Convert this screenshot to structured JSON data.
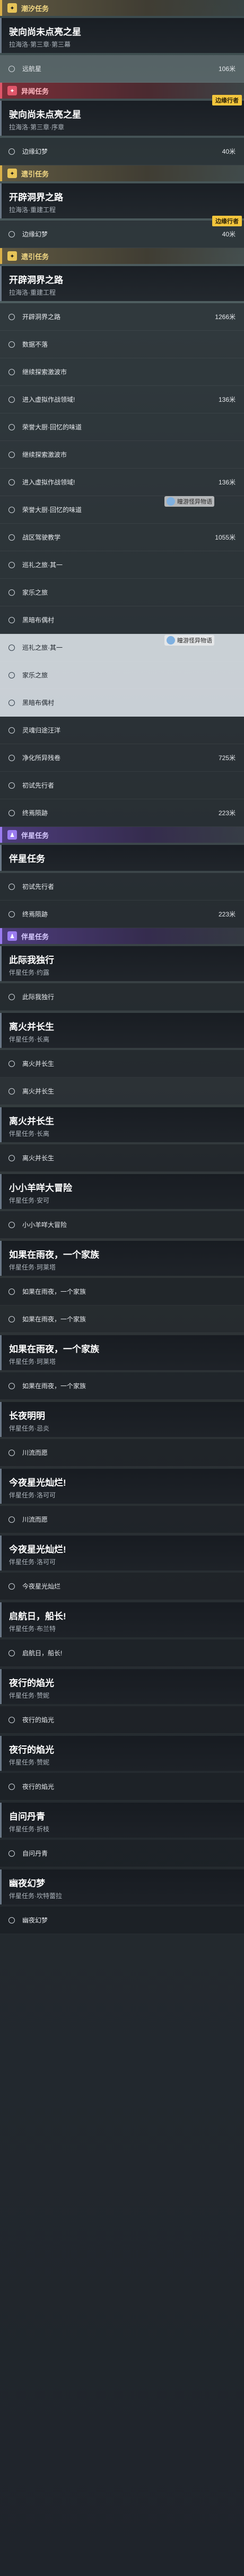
{
  "blocks": [
    {
      "type": "header",
      "style": "yellow",
      "icon": "✦",
      "text": "潮汐任务"
    },
    {
      "type": "card",
      "title": "驶向尚未点亮之星",
      "sub": "拉海洛·第三章·第三幕"
    },
    {
      "type": "row",
      "text": "远航星",
      "dist": "106米",
      "style": "sel"
    },
    {
      "type": "header",
      "style": "red",
      "icon": "✦",
      "text": "异闻任务"
    },
    {
      "type": "card",
      "title": "驶向尚未点亮之星",
      "sub": "拉海洛·第三章·序章",
      "tag": "边缘行者"
    },
    {
      "type": "row",
      "text": "边缘幻梦",
      "dist": "40米"
    },
    {
      "type": "header",
      "style": "yellow",
      "icon": "✦",
      "text": "遗引任务"
    },
    {
      "type": "card",
      "title": "开辟洞界之路",
      "sub": "拉海洛·重建工程"
    },
    {
      "type": "row",
      "text": "边缘幻梦",
      "dist": "40米",
      "tag": "边缘行者"
    },
    {
      "type": "header",
      "style": "yellow",
      "icon": "✦",
      "text": "遗引任务"
    },
    {
      "type": "card",
      "title": "开辟洞界之路",
      "sub": "拉海洛·重建工程"
    },
    {
      "type": "row",
      "text": "开辟洞界之路",
      "dist": "1266米"
    },
    {
      "type": "row",
      "text": "数据不落"
    },
    {
      "type": "row",
      "text": "继续探索激波市"
    },
    {
      "type": "row",
      "text": "进入虚拟作战领域!",
      "dist": "136米"
    },
    {
      "type": "row",
      "text": "荣誉大厨·回忆的味道"
    },
    {
      "type": "row",
      "text": "继续探索激波市"
    },
    {
      "type": "row",
      "text": "进入虚拟作战领域!",
      "dist": "136米"
    },
    {
      "type": "row",
      "text": "荣誉大厨·回忆的味道"
    },
    {
      "type": "row",
      "text": "战区驾驶教学",
      "dist": "1055米"
    },
    {
      "type": "row",
      "text": "巡礼之旅·其一"
    },
    {
      "type": "row",
      "text": "家乐之旅"
    },
    {
      "type": "row",
      "text": "黑暗布偶村"
    },
    {
      "type": "row",
      "text": "巡礼之旅·其一",
      "style": "light"
    },
    {
      "type": "row",
      "text": "家乐之旅",
      "style": "light"
    },
    {
      "type": "row",
      "text": "黑暗布偶村",
      "style": "light"
    },
    {
      "type": "row",
      "text": "灵魂归途汪洋"
    },
    {
      "type": "row",
      "text": "净化所异残卷",
      "dist": "725米"
    },
    {
      "type": "row",
      "text": "初试先行者"
    },
    {
      "type": "row",
      "text": "终焉陨跡",
      "dist": "223米"
    },
    {
      "type": "header",
      "style": "purple",
      "icon": "♟",
      "text": "伴星任务"
    },
    {
      "type": "card",
      "title": "伴星任务",
      "sub": ""
    },
    {
      "type": "row",
      "text": "初试先行者"
    },
    {
      "type": "row",
      "text": "终焉陨跡",
      "dist": "223米"
    },
    {
      "type": "header",
      "style": "purple",
      "icon": "♟",
      "text": "伴星任务"
    },
    {
      "type": "card",
      "title": "此际我独行",
      "sub": "伴星任务·约露"
    },
    {
      "type": "row",
      "text": "此际我独行"
    },
    {
      "type": "card",
      "title": "离火并长生",
      "sub": "伴星任务·长离"
    },
    {
      "type": "row",
      "text": "离火并长生"
    },
    {
      "type": "row",
      "text": "离火并长生",
      "style": "dim"
    },
    {
      "type": "card",
      "title": "离火并长生",
      "sub": "伴星任务·长离"
    },
    {
      "type": "row",
      "text": "离火并长生"
    },
    {
      "type": "card",
      "title": "小小羊咩大冒险",
      "sub": "伴星任务·安可"
    },
    {
      "type": "row",
      "text": "小小羊咩大冒险"
    },
    {
      "type": "card",
      "title": "如果在雨夜，一个家族",
      "sub": "伴星任务·珂莱塔"
    },
    {
      "type": "row",
      "text": "如果在雨夜，一个家族"
    },
    {
      "type": "row",
      "text": "如果在雨夜，一个家族",
      "style": "dim"
    },
    {
      "type": "card",
      "title": "如果在雨夜，一个家族",
      "sub": "伴星任务·珂莱塔"
    },
    {
      "type": "row",
      "text": "如果在雨夜，一个家族"
    },
    {
      "type": "card",
      "title": "长夜明明",
      "sub": "伴星任务·忌炎"
    },
    {
      "type": "row",
      "text": "川流而愿"
    },
    {
      "type": "card",
      "title": "今夜星光灿烂!",
      "sub": "伴星任务·洛可可"
    },
    {
      "type": "row",
      "text": "川流而愿"
    },
    {
      "type": "card",
      "title": "今夜星光灿烂!",
      "sub": "伴星任务·洛可可"
    },
    {
      "type": "row",
      "text": "今夜星光灿烂"
    },
    {
      "type": "card",
      "title": "启航日，船长!",
      "sub": "伴星任务·布兰特"
    },
    {
      "type": "row",
      "text": "启航日，船长!"
    },
    {
      "type": "card",
      "title": "夜行的焰光",
      "sub": "伴星任务·赞妮"
    },
    {
      "type": "row",
      "text": "夜行的焰光"
    },
    {
      "type": "card",
      "title": "夜行的焰光",
      "sub": "伴星任务·赞妮"
    },
    {
      "type": "row",
      "text": "夜行的焰光"
    },
    {
      "type": "card",
      "title": "自问丹青",
      "sub": "伴星任务·折枝"
    },
    {
      "type": "row",
      "text": "自问丹青"
    },
    {
      "type": "card",
      "title": "幽夜幻梦",
      "sub": "伴星任务·坎特蕾拉"
    },
    {
      "type": "row",
      "text": "幽夜幻梦"
    }
  ],
  "watermarks": [
    "瞳游怪异物语",
    "瞳游怪异物语"
  ]
}
